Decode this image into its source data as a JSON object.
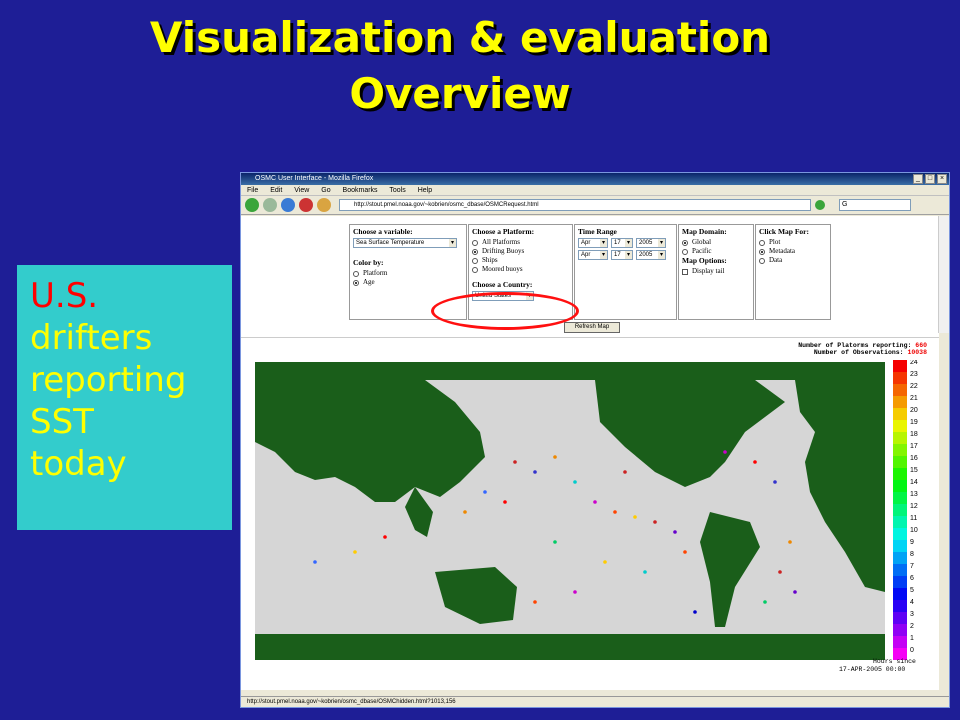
{
  "slide": {
    "title_line1": "Visualization & evaluation",
    "title_line2": "Overview",
    "callout_line1": "U.S.",
    "callout_line2": "drifters",
    "callout_line3": "reporting",
    "callout_line4": "SST",
    "callout_line5": "today"
  },
  "browser": {
    "window_title": "OSMC User Interface - Mozilla Firefox",
    "menu": [
      "File",
      "Edit",
      "View",
      "Go",
      "Bookmarks",
      "Tools",
      "Help"
    ],
    "url": "http://stout.pmel.noaa.gov/~kobrien/osmc_dbase/OSMCRequest.html",
    "search_value": "G",
    "status_url": "http://stout.pmel.noaa.gov/~kobrien/osmc_dbase/OSMChidden.html?1013,156"
  },
  "form": {
    "variable_label": "Choose a variable:",
    "variable_value": "Sea Surface Temperature",
    "colorby_label": "Color by:",
    "colorby_options": [
      "Platform",
      "Age"
    ],
    "platform_label": "Choose a Platform:",
    "platform_options": [
      "All Platforms",
      "Drifting Buoys",
      "Ships",
      "Moored buoys"
    ],
    "country_label": "Choose a Country:",
    "country_value": "United States",
    "time_label": "Time Range",
    "time_row1": [
      "Apr",
      "17",
      "2005"
    ],
    "time_row2": [
      "Apr",
      "17",
      "2005"
    ],
    "domain_label": "Map Domain:",
    "domain_options": [
      "Global",
      "Pacific"
    ],
    "mapopts_label": "Map Options:",
    "display_tail": "Display tail",
    "click_label": "Click Map For:",
    "click_options": [
      "Plot",
      "Metadata",
      "Data"
    ],
    "refresh_label": "Refresh Map"
  },
  "map": {
    "platforms_label": "Number of Platorms reporting:",
    "platforms_value": "660",
    "obs_label": "Number of Observations:",
    "obs_value": "10038",
    "legend_ticks": [
      "24",
      "23",
      "22",
      "21",
      "20",
      "19",
      "18",
      "17",
      "16",
      "15",
      "14",
      "13",
      "12",
      "11",
      "10",
      "9",
      "8",
      "7",
      "6",
      "5",
      "4",
      "3",
      "2",
      "1",
      "0"
    ],
    "legend_caption": "Hours since",
    "date_label": "17-APR-2005 00:00"
  }
}
